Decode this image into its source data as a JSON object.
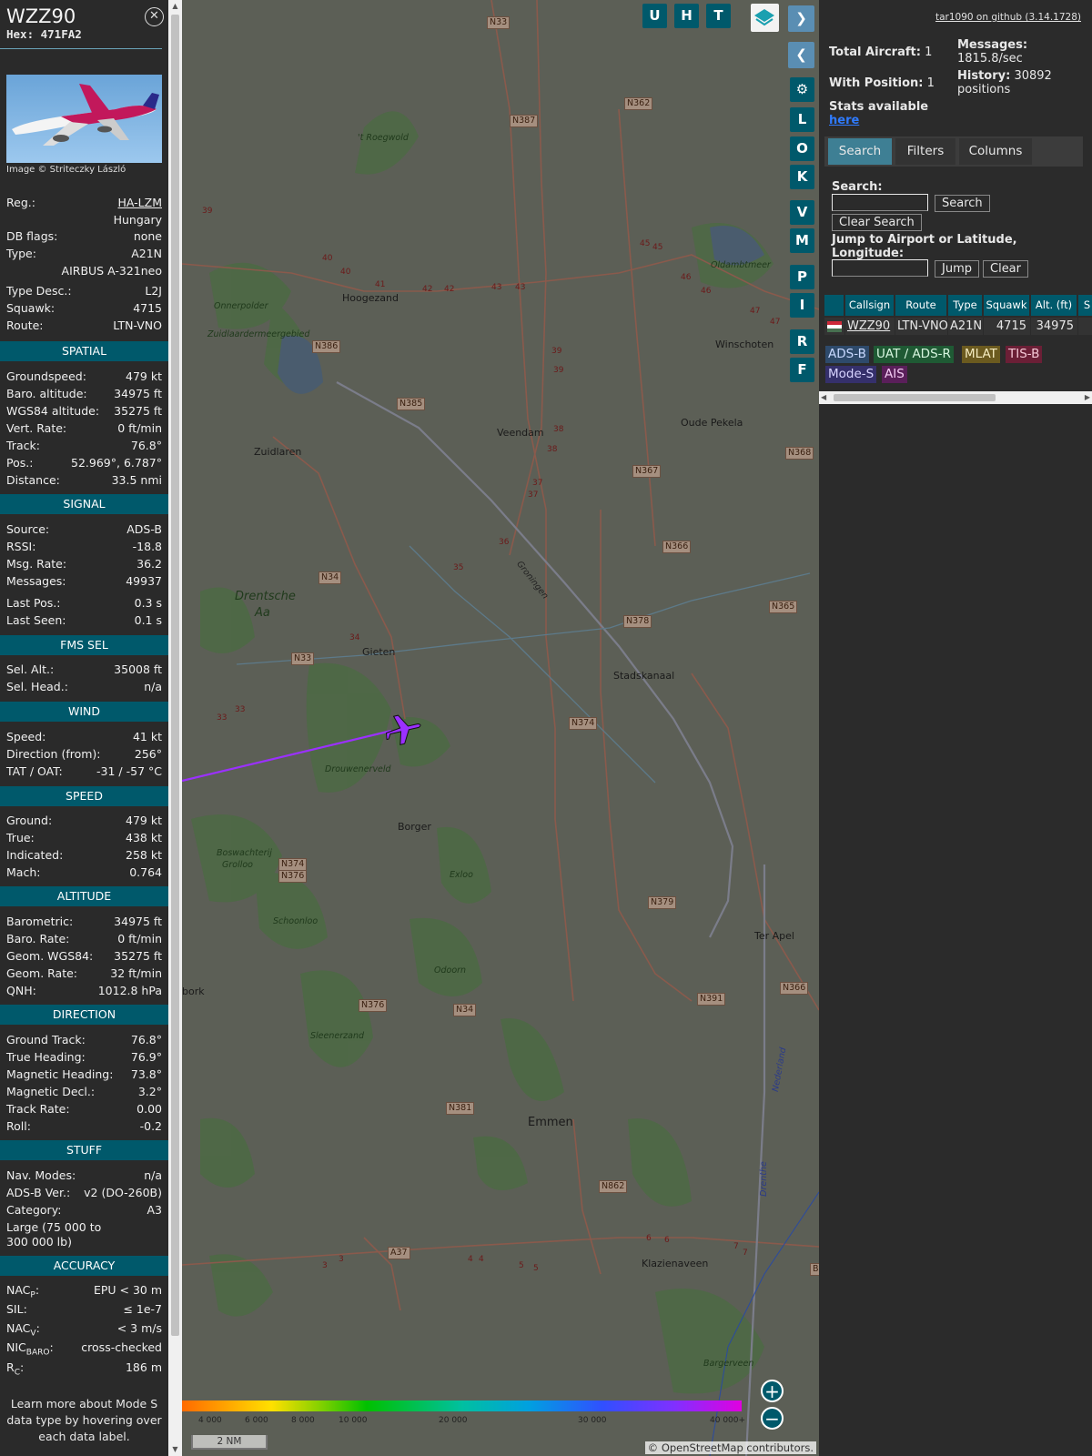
{
  "aircraft": {
    "callsign": "WZZ90",
    "hex": "Hex:  471FA2",
    "photo_credit": "Image © Striteczky László",
    "rows_top": [
      {
        "label": "Reg.:",
        "value": "HA-LZM",
        "link": true
      },
      {
        "label": "",
        "value": "Hungary"
      },
      {
        "label": "DB flags:",
        "value": "none"
      },
      {
        "label": "Type:",
        "value": "A21N"
      },
      {
        "label": "",
        "value": "AIRBUS A-321neo"
      },
      {
        "label": "Type Desc.:",
        "value": "L2J"
      },
      {
        "label": "Squawk:",
        "value": "4715"
      },
      {
        "label": "Route:",
        "value": "LTN-VNO"
      }
    ]
  },
  "sections": {
    "spatial": {
      "title": "SPATIAL",
      "rows": [
        {
          "label": "Groundspeed:",
          "value": "479 kt"
        },
        {
          "label": "Baro. altitude:",
          "value": "34975 ft"
        },
        {
          "label": "WGS84 altitude:",
          "value": "35275 ft"
        },
        {
          "label": "Vert. Rate:",
          "value": "0 ft/min"
        },
        {
          "label": "Track:",
          "value": "76.8°"
        },
        {
          "label": "Pos.:",
          "value": "52.969°, 6.787°"
        },
        {
          "label": "Distance:",
          "value": "33.5 nmi"
        }
      ]
    },
    "signal": {
      "title": "SIGNAL",
      "rows": [
        {
          "label": "Source:",
          "value": "ADS-B"
        },
        {
          "label": "RSSI:",
          "value": "-18.8"
        },
        {
          "label": "Msg. Rate:",
          "value": "36.2"
        },
        {
          "label": "Messages:",
          "value": "49937"
        },
        {
          "label": "Last Pos.:",
          "value": "0.3 s"
        },
        {
          "label": "Last Seen:",
          "value": "0.1 s"
        }
      ]
    },
    "fms": {
      "title": "FMS SEL",
      "rows": [
        {
          "label": "Sel. Alt.:",
          "value": "35008 ft"
        },
        {
          "label": "Sel. Head.:",
          "value": "n/a"
        }
      ]
    },
    "wind": {
      "title": "WIND",
      "rows": [
        {
          "label": "Speed:",
          "value": "41 kt"
        },
        {
          "label": "Direction (from):",
          "value": "256°"
        },
        {
          "label": "TAT / OAT:",
          "value": "-31 / -57 °C"
        }
      ]
    },
    "speed": {
      "title": "SPEED",
      "rows": [
        {
          "label": "Ground:",
          "value": "479 kt"
        },
        {
          "label": "True:",
          "value": "438 kt"
        },
        {
          "label": "Indicated:",
          "value": "258 kt"
        },
        {
          "label": "Mach:",
          "value": "0.764"
        }
      ]
    },
    "altitude": {
      "title": "ALTITUDE",
      "rows": [
        {
          "label": "Barometric:",
          "value": "34975 ft"
        },
        {
          "label": "Baro. Rate:",
          "value": "0 ft/min"
        },
        {
          "label": "Geom. WGS84:",
          "value": "35275 ft"
        },
        {
          "label": "Geom. Rate:",
          "value": "32 ft/min"
        },
        {
          "label": "QNH:",
          "value": "1012.8 hPa"
        }
      ]
    },
    "direction": {
      "title": "DIRECTION",
      "rows": [
        {
          "label": "Ground Track:",
          "value": "76.8°"
        },
        {
          "label": "True Heading:",
          "value": "76.9°"
        },
        {
          "label": "Magnetic Heading:",
          "value": "73.8°"
        },
        {
          "label": "Magnetic Decl.:",
          "value": "3.2°"
        },
        {
          "label": "Track Rate:",
          "value": "0.00"
        },
        {
          "label": "Roll:",
          "value": "-0.2"
        }
      ]
    },
    "stuff": {
      "title": "STUFF",
      "rows": [
        {
          "label": "Nav. Modes:",
          "value": "n/a"
        },
        {
          "label": "ADS-B Ver.:",
          "value": "v2 (DO-260B)"
        },
        {
          "label": "Category:",
          "value": "A3"
        }
      ],
      "category_desc_1": "Large (75 000 to",
      "category_desc_2": "300 000 lb)"
    },
    "accuracy": {
      "title": "ACCURACY",
      "rows": [
        {
          "label_main": "NAC",
          "label_sub": "P",
          "value": "EPU < 30 m"
        },
        {
          "label_main": "SIL:",
          "label_sub": "",
          "value": "≤ 1e-7"
        },
        {
          "label_main": "NAC",
          "label_sub": "V",
          "value": "< 3 m/s"
        },
        {
          "label_main": "NIC",
          "label_sub": "BARO",
          "value": "cross-checked"
        },
        {
          "label_main": "R",
          "label_sub": "C",
          "value": "186 m"
        }
      ]
    }
  },
  "footer": {
    "line1": "Learn more about Mode S",
    "line2": "data type by hovering over",
    "line3": "each data label."
  },
  "map": {
    "buttons_top": [
      "U",
      "H",
      "T"
    ],
    "buttons_side": [
      "L",
      "O",
      "K",
      "V",
      "M",
      "P",
      "I",
      "R",
      "F"
    ],
    "places": [
      {
        "name": "Hoogezand",
        "kind": "town"
      },
      {
        "name": "Veendam",
        "kind": "town"
      },
      {
        "name": "Winschoten",
        "kind": "town"
      },
      {
        "name": "Oude Pekela",
        "kind": "town"
      },
      {
        "name": "Zuidlaren",
        "kind": "town"
      },
      {
        "name": "Gieten",
        "kind": "town"
      },
      {
        "name": "Stadskanaal",
        "kind": "town"
      },
      {
        "name": "Borger",
        "kind": "town"
      },
      {
        "name": "Ter Apel",
        "kind": "town"
      },
      {
        "name": "Emmen",
        "kind": "city"
      },
      {
        "name": "Klazienaveen",
        "kind": "town"
      },
      {
        "name": "bork",
        "kind": "town"
      },
      {
        "name": "Drentsche",
        "kind": "park"
      },
      {
        "name": "Aa",
        "kind": "park"
      },
      {
        "name": "'t Roegwold",
        "kind": "forest"
      },
      {
        "name": "Onnerpolder",
        "kind": "forest"
      },
      {
        "name": "Zuidlaardermeergebied",
        "kind": "forest"
      },
      {
        "name": "Oldambtmeer",
        "kind": "forest"
      },
      {
        "name": "Drouwenerveld",
        "kind": "forest"
      },
      {
        "name": "Boswachterij",
        "kind": "forest"
      },
      {
        "name": "Grolloo",
        "kind": "forest"
      },
      {
        "name": "Exloo",
        "kind": "forest"
      },
      {
        "name": "Schoonloo",
        "kind": "forest"
      },
      {
        "name": "Odoorn",
        "kind": "forest"
      },
      {
        "name": "Sleenerzand",
        "kind": "forest"
      },
      {
        "name": "Bargerveen",
        "kind": "forest"
      },
      {
        "name": "Groningen",
        "kind": "rail"
      },
      {
        "name": "Nederland",
        "kind": "border"
      },
      {
        "name": "Drenthe",
        "kind": "border"
      }
    ],
    "roads": [
      "N33",
      "N387",
      "N362",
      "N386",
      "N385",
      "N367",
      "N368",
      "N366",
      "N34",
      "N378",
      "N365",
      "N374",
      "N376",
      "N379",
      "N391",
      "N381",
      "N862",
      "A37",
      "B"
    ],
    "km_markers": [
      "39",
      "40",
      "40",
      "41",
      "42",
      "42",
      "43",
      "43",
      "45",
      "45",
      "46",
      "46",
      "47",
      "47",
      "39",
      "39",
      "38",
      "38",
      "37",
      "37",
      "36",
      "35",
      "34",
      "33",
      "33",
      "3",
      "3",
      "4",
      "4",
      "5",
      "5",
      "6",
      "6",
      "7",
      "7"
    ],
    "scale_label": "2 NM",
    "attribution": "© OpenStreetMap contributors.",
    "alt_ticks": [
      "4 000",
      "6 000",
      "8 000",
      "10 000",
      "20 000",
      "30 000",
      "40 000+"
    ],
    "zoom_in": "+",
    "zoom_out": "−",
    "track_color": "#9b30ff",
    "plane_color": "#9b30ff"
  },
  "panel": {
    "github": "tar1090 on github (3.14.1728)",
    "total_label": "Total Aircraft:",
    "total_value": "1",
    "with_pos_label": "With Position:",
    "with_pos_value": "1",
    "stats_label": "Stats available",
    "stats_link": "here",
    "messages_label": "Messages:",
    "messages_value": "1815.8/sec",
    "history_label": "History:",
    "history_value": "30892",
    "history_unit": "positions",
    "tabs": [
      "Search",
      "Filters",
      "Columns"
    ],
    "search_label": "Search:",
    "search_button": "Search",
    "clear_search_button": "Clear Search",
    "jump_label_1": "Jump to Airport or Latitude,",
    "jump_label_2": "Longitude:",
    "jump_button": "Jump",
    "clear_button": "Clear",
    "columns": [
      "",
      "Callsign",
      "Route",
      "Type",
      "Squawk",
      "Alt. (ft)",
      "S"
    ],
    "row": {
      "callsign": "WZZ90",
      "route": "LTN-VNO",
      "type": "A21N",
      "squawk": "4715",
      "alt": "34975"
    },
    "badges": [
      {
        "label": "ADS-B",
        "color": "#2e4a6b",
        "text": "#c8d8ff"
      },
      {
        "label": "UAT / ADS-R",
        "color": "#1f5a34",
        "text": "#d6f5de"
      },
      {
        "label": "MLAT",
        "color": "#6b5a1f",
        "text": "#f5ecc0"
      },
      {
        "label": "TIS-B",
        "color": "#6b1f36",
        "text": "#f5c8d6"
      },
      {
        "label": "Mode-S",
        "color": "#35306b",
        "text": "#d8d4ff"
      },
      {
        "label": "AIS",
        "color": "#5a1f5a",
        "text": "#f5cdf5"
      }
    ]
  },
  "colors": {
    "accent": "#00596b",
    "tab_active": "#3e7f94"
  }
}
